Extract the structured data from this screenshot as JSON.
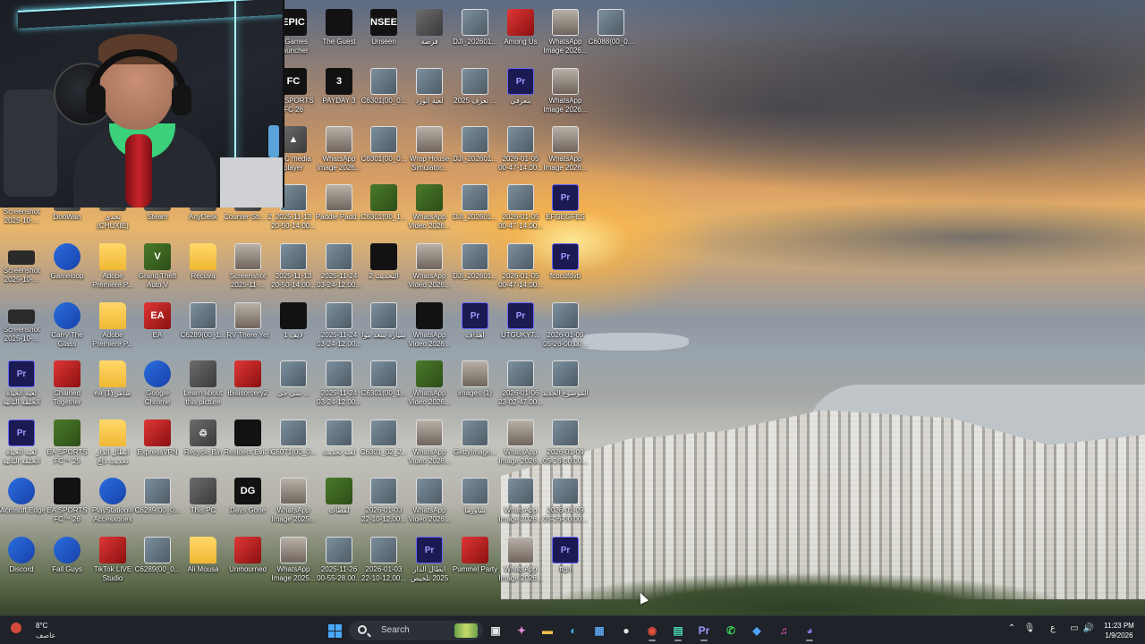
{
  "desktop": {
    "icons": [
      {
        "label": "c Games Launcher",
        "type": "dark",
        "glyph": "EPIC"
      },
      {
        "label": "The Guest",
        "type": "dark",
        "glyph": ""
      },
      {
        "label": "Unseen",
        "type": "dark",
        "glyph": "UNSEEN"
      },
      {
        "label": "قرصة",
        "type": "app",
        "glyph": ""
      },
      {
        "label": "DJI_202601...",
        "type": "photo",
        "glyph": ""
      },
      {
        "label": "Among Us",
        "type": "red",
        "glyph": ""
      },
      {
        "label": "WhatsApp Image 2026...",
        "type": "person",
        "glyph": ""
      },
      {
        "label": "C6088(00_0...",
        "type": "photo",
        "glyph": ""
      },
      {
        "label": "EA SPORTS FC 26",
        "type": "dark",
        "glyph": "FC"
      },
      {
        "label": "PAYDAY 3",
        "type": "dark",
        "glyph": "3"
      },
      {
        "label": "C6301(00_0...",
        "type": "photo",
        "glyph": ""
      },
      {
        "label": "لعبة الورد",
        "type": "photo",
        "glyph": ""
      },
      {
        "label": "تعرف 2025 ...",
        "type": "photo",
        "glyph": ""
      },
      {
        "label": "بتعرفي",
        "type": "pr",
        "glyph": "Pr"
      },
      {
        "label": "WhatsApp Image 2026...",
        "type": "person",
        "glyph": ""
      },
      {
        "label": "VLC media player",
        "type": "app",
        "glyph": "▲"
      },
      {
        "label": "WhatsApp Image 2026...",
        "type": "person",
        "glyph": ""
      },
      {
        "label": "C6301(00_0...",
        "type": "photo",
        "glyph": ""
      },
      {
        "label": "Wrap House Simulator...",
        "type": "person",
        "glyph": ""
      },
      {
        "label": "DJI_202601...",
        "type": "photo",
        "glyph": ""
      },
      {
        "label": "2026-01-05 00-47-14.00...",
        "type": "photo",
        "glyph": ""
      },
      {
        "label": "WhatsApp Image 2026...",
        "type": "person",
        "glyph": ""
      },
      {
        "label": "Screenshot 2025-10-...",
        "type": "shot",
        "glyph": ""
      },
      {
        "label": "DooWan",
        "type": "app",
        "glyph": ""
      },
      {
        "label": "تحدي (CHUXIE)",
        "type": "app",
        "glyph": ""
      },
      {
        "label": "Steam",
        "type": "app",
        "glyph": ""
      },
      {
        "label": "AnyDesk",
        "type": "app",
        "glyph": ""
      },
      {
        "label": "Counter Str... 2",
        "type": "app",
        "glyph": ""
      },
      {
        "label": "2025-11-13 20-50-14.00...",
        "type": "photo",
        "glyph": ""
      },
      {
        "label": "Paddle Padd...",
        "type": "person",
        "glyph": ""
      },
      {
        "label": "C6301(00_1...",
        "type": "green",
        "glyph": ""
      },
      {
        "label": "WhatsApp Video 2026...",
        "type": "green",
        "glyph": ""
      },
      {
        "label": "DJI_202601...",
        "type": "photo",
        "glyph": ""
      },
      {
        "label": "2026-01-05 00-47-14.00...",
        "type": "photo",
        "glyph": ""
      },
      {
        "label": "EFGEGFES",
        "type": "pr",
        "glyph": "Pr"
      },
      {
        "label": "Screenshot 2025-10-...",
        "type": "shot",
        "glyph": ""
      },
      {
        "label": "Gameloop",
        "type": "blue",
        "glyph": ""
      },
      {
        "label": "Adobe Premiere P...",
        "type": "folder",
        "glyph": ""
      },
      {
        "label": "Grand Theft Auto V",
        "type": "green",
        "glyph": "V"
      },
      {
        "label": "Recuva",
        "type": "folder",
        "glyph": ""
      },
      {
        "label": "Screenshot 2025-11-...",
        "type": "person",
        "glyph": ""
      },
      {
        "label": "2025-11-13 20-50-14.00...",
        "type": "photo",
        "glyph": ""
      },
      {
        "label": "2025-11-24 03-24-12.00...",
        "type": "photo",
        "glyph": ""
      },
      {
        "label": "التحديث 2",
        "type": "dark",
        "glyph": ""
      },
      {
        "label": "WhatsApp Video 2026...",
        "type": "person",
        "glyph": ""
      },
      {
        "label": "DJI_202601...",
        "type": "photo",
        "glyph": ""
      },
      {
        "label": "2026-01-05 00-47-14.00...",
        "type": "photo",
        "glyph": ""
      },
      {
        "label": "fcbcdfdvb",
        "type": "pr",
        "glyph": "Pr"
      },
      {
        "label": "Screenshot 2025-10-...",
        "type": "shot",
        "glyph": ""
      },
      {
        "label": "Carry The Glass",
        "type": "blue",
        "glyph": ""
      },
      {
        "label": "Adobe Premiere P...",
        "type": "folder",
        "glyph": ""
      },
      {
        "label": "EA",
        "type": "red",
        "glyph": "EA"
      },
      {
        "label": "C6289(00_1...",
        "type": "photo",
        "glyph": ""
      },
      {
        "label": "RV There Yet",
        "type": "person",
        "glyph": ""
      },
      {
        "label": "لايف 1",
        "type": "dark",
        "glyph": ""
      },
      {
        "label": "2025-11-24 03-24-12.00...",
        "type": "photo",
        "glyph": ""
      },
      {
        "label": "سيارة سعد موا",
        "type": "photo",
        "glyph": ""
      },
      {
        "label": "WhatsApp Video 2026...",
        "type": "dark",
        "glyph": ""
      },
      {
        "label": "اهداف",
        "type": "pr",
        "glyph": "Pr"
      },
      {
        "label": "UTGUKYT...",
        "type": "pr",
        "glyph": "Pr"
      },
      {
        "label": "2026-01-09 05-26-00.00...",
        "type": "photo",
        "glyph": ""
      },
      {
        "label": "لعبة الحياة الحلقة الثانية",
        "type": "pr",
        "glyph": "Pr"
      },
      {
        "label": "Chained Together",
        "type": "red",
        "glyph": ""
      },
      {
        "label": "ea سامر (1)",
        "type": "folder",
        "glyph": ""
      },
      {
        "label": "Google Chrome",
        "type": "blue",
        "glyph": ""
      },
      {
        "label": "Learn about this picture",
        "type": "app",
        "glyph": ""
      },
      {
        "label": "ibisisorcery2",
        "type": "red",
        "glyph": ""
      },
      {
        "label": "سي جي ...",
        "type": "photo",
        "glyph": ""
      },
      {
        "label": "2025-11-24 03-24-12.00...",
        "type": "photo",
        "glyph": ""
      },
      {
        "label": "C6301(00_1...",
        "type": "photo",
        "glyph": ""
      },
      {
        "label": "WhatsApp Video 2026...",
        "type": "green",
        "glyph": ""
      },
      {
        "label": "images (1)",
        "type": "person",
        "glyph": ""
      },
      {
        "label": "2026-01-06 23-02-47.00...",
        "type": "photo",
        "glyph": ""
      },
      {
        "label": "الموضوع الجديد",
        "type": "photo",
        "glyph": ""
      },
      {
        "label": "لعبة الحياة الحلقة الثانية",
        "type": "pr",
        "glyph": "Pr"
      },
      {
        "label": "EA SPORTS FC™ 25",
        "type": "green",
        "glyph": ""
      },
      {
        "label": "ابطال الدار تحديث داخ",
        "type": "folder",
        "glyph": ""
      },
      {
        "label": "ExpressVPN",
        "type": "red",
        "glyph": ""
      },
      {
        "label": "Recycle Bin",
        "type": "app",
        "glyph": "♲"
      },
      {
        "label": "Resident Evil 4",
        "type": "dark",
        "glyph": ""
      },
      {
        "label": "C6071(00_0...",
        "type": "photo",
        "glyph": ""
      },
      {
        "label": "لعبة تحديث",
        "type": "photo",
        "glyph": ""
      },
      {
        "label": "C6301_02_2...",
        "type": "photo",
        "glyph": ""
      },
      {
        "label": "WhatsApp Video 2026...",
        "type": "person",
        "glyph": ""
      },
      {
        "label": "GettyImage...",
        "type": "photo",
        "glyph": ""
      },
      {
        "label": "WhatsApp Image 2026...",
        "type": "person",
        "glyph": ""
      },
      {
        "label": "2026-01-09 05-26-00.00...",
        "type": "photo",
        "glyph": ""
      },
      {
        "label": "Microsoft Edge",
        "type": "blue",
        "glyph": ""
      },
      {
        "label": "EA SPORTS FC™ 26",
        "type": "dark",
        "glyph": ""
      },
      {
        "label": "PlayStation® Accessories",
        "type": "blue",
        "glyph": ""
      },
      {
        "label": "C6289(00_0...",
        "type": "photo",
        "glyph": ""
      },
      {
        "label": "This PC",
        "type": "app",
        "glyph": ""
      },
      {
        "label": "Days Gone",
        "type": "dark",
        "glyph": "DG"
      },
      {
        "label": "WhatsApp Image 2025...",
        "type": "person",
        "glyph": ""
      },
      {
        "label": "لقطات",
        "type": "green",
        "glyph": ""
      },
      {
        "label": "2026-01-03 22-10-12.00...",
        "type": "photo",
        "glyph": ""
      },
      {
        "label": "WhatsApp Video 2026...",
        "type": "photo",
        "glyph": ""
      },
      {
        "label": "شاورما",
        "type": "photo",
        "glyph": ""
      },
      {
        "label": "WhatsApp Image 2026...",
        "type": "photo",
        "glyph": ""
      },
      {
        "label": "2026-01-09 05-26-00.00...",
        "type": "photo",
        "glyph": ""
      },
      {
        "label": "Discord",
        "type": "blue",
        "glyph": ""
      },
      {
        "label": "Fall Guys",
        "type": "blue",
        "glyph": ""
      },
      {
        "label": "TikTok LIVE Studio",
        "type": "red",
        "glyph": ""
      },
      {
        "label": "C6289(00_0...",
        "type": "photo",
        "glyph": ""
      },
      {
        "label": "Ali Mousa",
        "type": "folder",
        "glyph": ""
      },
      {
        "label": "Unmourned",
        "type": "red",
        "glyph": ""
      },
      {
        "label": "WhatsApp Image 2025...",
        "type": "person",
        "glyph": ""
      },
      {
        "label": "2025-11-26 00-55-28.00...",
        "type": "photo",
        "glyph": ""
      },
      {
        "label": "2026-01-03 22-10-12.00...",
        "type": "photo",
        "glyph": ""
      },
      {
        "label": "ابطال الدار 2025 تلخيص",
        "type": "pr",
        "glyph": "Pr"
      },
      {
        "label": "Pummel Party",
        "type": "red",
        "glyph": ""
      },
      {
        "label": "WhatsApp Image 2026...",
        "type": "person",
        "glyph": ""
      },
      {
        "label": "ffgh",
        "type": "pr",
        "glyph": "Pr"
      }
    ]
  },
  "taskbar": {
    "weather_temp": "8°C",
    "weather_cond": "عاصف",
    "search_placeholder": "Search",
    "time": "11:23 PM",
    "date": "1/9/2026",
    "tray_lang": "ع",
    "apps": [
      {
        "name": "start-icon",
        "glyph": "⊞",
        "color": "#4aa8ff"
      },
      {
        "name": "task-view-icon",
        "glyph": "▣",
        "color": "#e6e6e6"
      },
      {
        "name": "copilot-icon",
        "glyph": "✦",
        "color": "#e48ad8"
      },
      {
        "name": "file-explorer-icon",
        "glyph": "▬",
        "color": "#f2c14a"
      },
      {
        "name": "edge-icon",
        "glyph": "◐",
        "color": "#3fb6e8"
      },
      {
        "name": "store-icon",
        "glyph": "▦",
        "color": "#5aa0e6"
      },
      {
        "name": "pin-icon",
        "glyph": "●",
        "color": "#e6e6e6"
      },
      {
        "name": "chrome-icon",
        "glyph": "◉",
        "color": "#e8513c"
      },
      {
        "name": "stream-app-icon",
        "glyph": "▤",
        "color": "#49d2b0"
      },
      {
        "name": "premiere-icon",
        "glyph": "Pr",
        "color": "#9c9cff"
      },
      {
        "name": "whatsapp-icon",
        "glyph": "✆",
        "color": "#3ecf5a"
      },
      {
        "name": "app-blue-icon",
        "glyph": "◆",
        "color": "#4da3ff"
      },
      {
        "name": "itunes-icon",
        "glyph": "♫",
        "color": "#ff5bd0"
      },
      {
        "name": "discord-icon",
        "glyph": "◕",
        "color": "#8a7cff"
      }
    ]
  }
}
